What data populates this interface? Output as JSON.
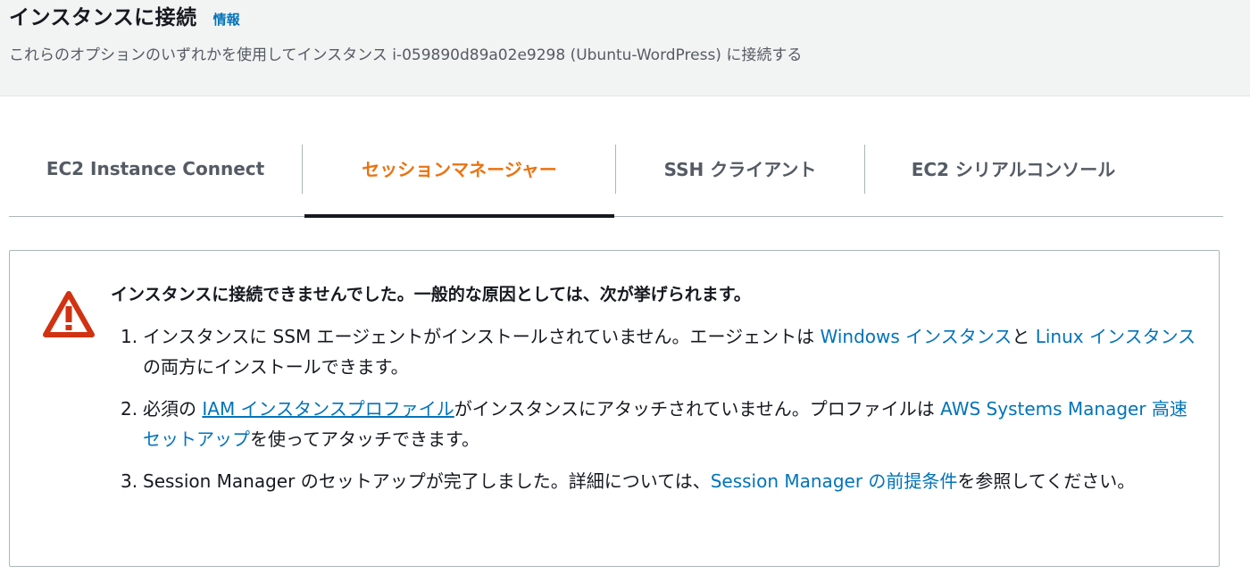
{
  "header": {
    "title": "インスタンスに接続",
    "info_link": "情報",
    "subtitle": "これらのオプションのいずれかを使用してインスタンス i-059890d89a02e9298 (Ubuntu-WordPress) に接続する"
  },
  "tabs": [
    {
      "label": "EC2 Instance Connect",
      "active": false
    },
    {
      "label": "セッションマネージャー",
      "active": true
    },
    {
      "label": "SSH クライアント",
      "active": false
    },
    {
      "label": "EC2 シリアルコンソール",
      "active": false
    }
  ],
  "alert": {
    "icon": "warning-triangle-icon",
    "heading": "インスタンスに接続できませんでした。一般的な原因としては、次が挙げられます。",
    "items": [
      {
        "num": "1.",
        "text1": "インスタンスに SSM エージェントがインストールされていません。エージェントは ",
        "link1": "Windows インスタンス",
        "text2": "と ",
        "link2": "Linux インスタンス",
        "text3": "の両方にインストールできます。"
      },
      {
        "num": "2.",
        "text1": "必須の ",
        "link1": "IAM インスタンスプロファイル",
        "text2": "がインスタンスにアタッチされていません。プロファイルは ",
        "link2": "AWS Systems Manager 高速セットアップ",
        "text3": "を使ってアタッチできます。"
      },
      {
        "num": "3.",
        "text1": "Session Manager のセットアップが完了しました。詳細については、",
        "link1": "Session Manager の前提条件",
        "text2": "を参照してください。"
      }
    ]
  },
  "colors": {
    "active_tab": "#ec7211",
    "link": "#0073bb",
    "warning": "#d13212"
  }
}
